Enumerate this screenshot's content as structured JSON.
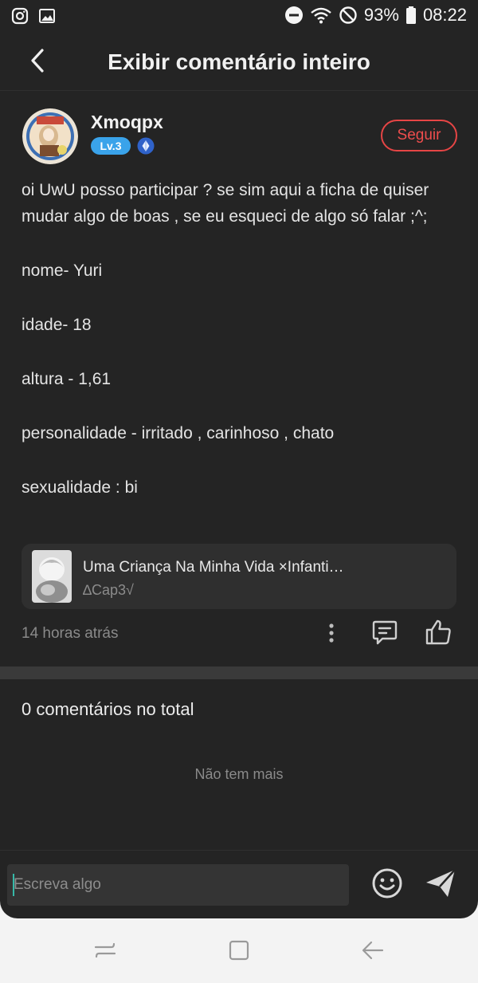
{
  "status_bar": {
    "battery": "93%",
    "time": "08:22",
    "icons": [
      "instagram-icon",
      "gallery-icon",
      "dnd-icon",
      "wifi-icon",
      "no-signal-icon",
      "battery-icon"
    ]
  },
  "header": {
    "title": "Exibir comentário inteiro",
    "back_icon": "back-arrow-icon"
  },
  "author": {
    "name": "Xmoqpx",
    "level": "Lv.3",
    "follow_label": "Seguir"
  },
  "comment": {
    "paragraphs": [
      "oi UwU posso participar ? se sim aqui a ficha de quiser mudar algo de boas , se eu esqueci de algo só falar ;^;",
      "nome- Yuri",
      "idade- 18",
      "altura - 1,61",
      "personalidade - irritado , carinhoso , chato",
      "sexualidade : bi"
    ]
  },
  "linked_story": {
    "title": "Uma Criança Na Minha Vida ×Infanti…",
    "subtitle": "∆Cap3√"
  },
  "meta": {
    "timestamp": "14 horas atrás"
  },
  "replies": {
    "total_label": "0 comentários no total",
    "empty_label": "Não tem mais"
  },
  "composer": {
    "placeholder": "Escreva algo"
  },
  "colors": {
    "background": "#242424",
    "accent_red": "#e64545",
    "level_blue": "#3aa3ea",
    "caret_teal": "#36b9a8"
  }
}
